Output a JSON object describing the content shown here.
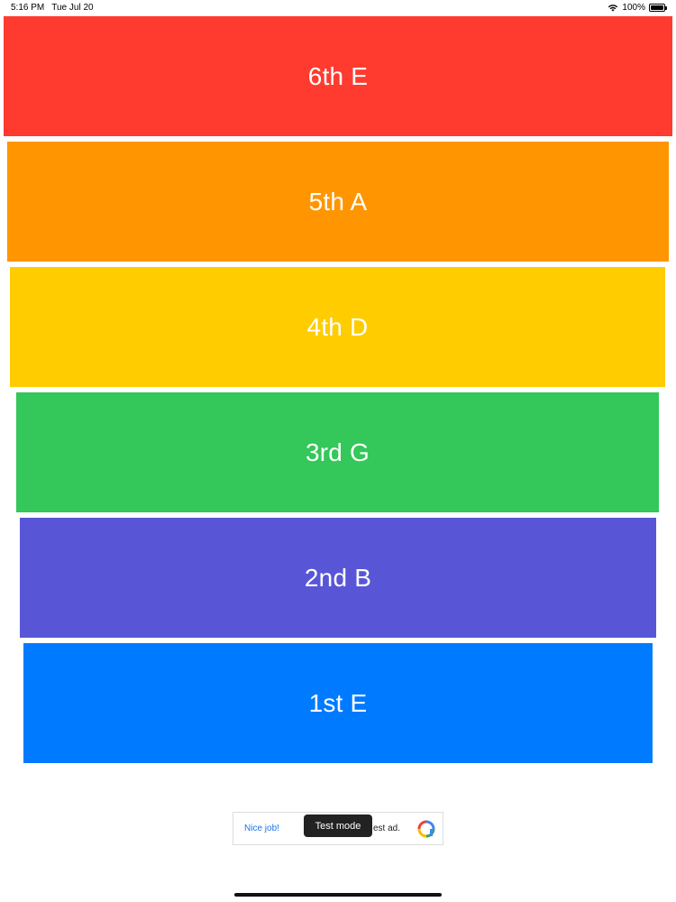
{
  "status_bar": {
    "time": "5:16 PM",
    "date": "Tue Jul 20",
    "battery": "100%",
    "wifi_icon": "wifi-icon",
    "battery_icon": "battery-icon"
  },
  "bands": [
    {
      "label": "6th E",
      "color": "#FF3B30"
    },
    {
      "label": "5th A",
      "color": "#FF9500"
    },
    {
      "label": "4th D",
      "color": "#FFCC00"
    },
    {
      "label": "3rd G",
      "color": "#34C759"
    },
    {
      "label": "2nd B",
      "color": "#5856D6"
    },
    {
      "label": "1st E",
      "color": "#007AFF"
    }
  ],
  "ad": {
    "left_text": "Nice job!",
    "right_text": "est ad.",
    "badge": "Test mode",
    "logo_icon": "ad-brand-icon"
  }
}
